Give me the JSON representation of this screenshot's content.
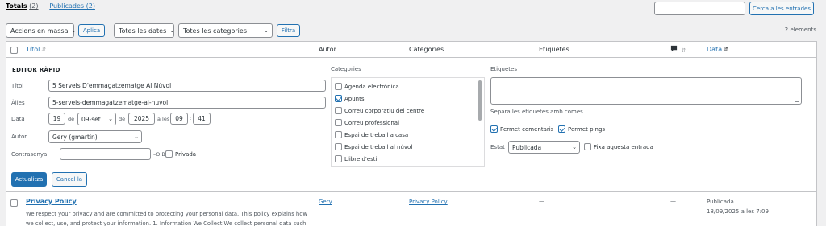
{
  "views": {
    "all_label": "Totals",
    "all_count": "(2)",
    "separator": "|",
    "published_label": "Publicades (2)"
  },
  "search": {
    "button": "Cerca a les entrades"
  },
  "filters": {
    "bulk_action": "Accions en massa",
    "apply": "Aplica",
    "dates": "Totes les dates",
    "categories": "Totes les categories",
    "filter": "Filtra",
    "items_count": "2 elements"
  },
  "columns": {
    "title": "Títol",
    "author": "Autor",
    "categories": "Categories",
    "tags": "Etiquetes",
    "date": "Data"
  },
  "quick_edit": {
    "heading": "EDITOR RÀPID",
    "title_label": "Títol",
    "title_value": "5 Serveis D'emmagatzematge Al Núvol",
    "slug_label": "Àlies",
    "slug_value": "5-serveis-demmagatzematge-al-nuvol",
    "date_label": "Data",
    "day": "19",
    "de1": "de",
    "month": "09-set.",
    "de2": "de",
    "year": "2025",
    "a_les": "a les",
    "hour": "09",
    "colon": ":",
    "minute": "41",
    "author_label": "Autor",
    "author_value": "Gery (gmartin)",
    "password_label": "Contrasenya",
    "or_label": "–O BÉ–",
    "private_label": "Privada",
    "categories_label": "Categories",
    "categories": [
      {
        "name": "Agenda electrònica",
        "checked": false
      },
      {
        "name": "Apunts",
        "checked": true
      },
      {
        "name": "Correu corporatiu del centre",
        "checked": false
      },
      {
        "name": "Correu professional",
        "checked": false
      },
      {
        "name": "Espai de treball a casa",
        "checked": false
      },
      {
        "name": "Espai de treball al núvol",
        "checked": false
      },
      {
        "name": "Llibre d'estil",
        "checked": false
      }
    ],
    "tags_label": "Etiquetes",
    "tags_help": "Separa les etiquetes amb comes",
    "allow_comments": "Permet comentaris",
    "allow_pings": "Permet pings",
    "status_label": "Estat",
    "status_value": "Publicada",
    "sticky_label": "Fixa aquesta entrada",
    "update_button": "Actualitza",
    "cancel_button": "Cancel·la"
  },
  "row": {
    "title": "Privacy Policy",
    "excerpt": "We respect your privacy and are committed to protecting your personal data. This policy explains how we collect, use, and protect your information. 1. Information We Collect We collect personal data such",
    "author": "Gery",
    "category": "Privacy Policy",
    "tags": "—",
    "comments": "—",
    "status": "Publicada",
    "date": "18/09/2025 a les 7:09"
  },
  "colors": {
    "accent": "#2271b1",
    "background": "#f0f0f1",
    "border": "#c3c4c7"
  }
}
